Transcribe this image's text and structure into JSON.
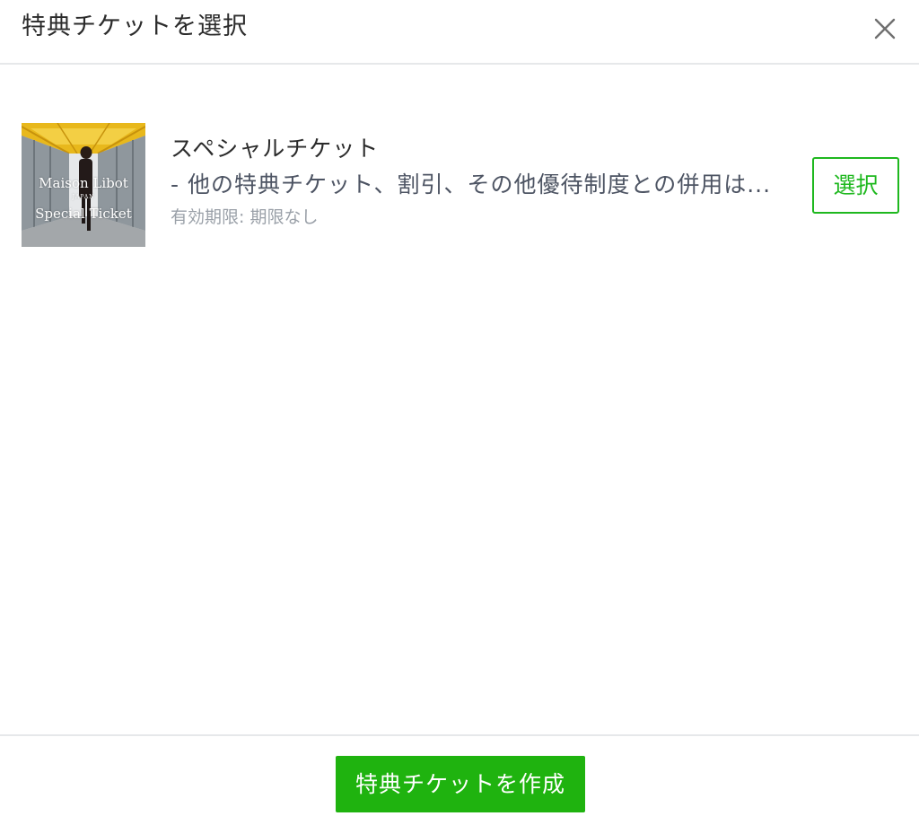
{
  "header": {
    "title": "特典チケットを選択",
    "close_icon": "close-icon"
  },
  "tickets": [
    {
      "name": "スペシャルチケット",
      "description": "- 他の特典チケット、割引、その他優待制度との併用は...",
      "expiry": "有効期限: 期限なし",
      "select_label": "選択",
      "thumbnail": {
        "line1": "Maison Libot",
        "line2": "JAPAN",
        "line3": "Special Ticket"
      }
    }
  ],
  "footer": {
    "create_label": "特典チケットを作成"
  },
  "colors": {
    "accent_green": "#1fb30f",
    "divider": "#e6e8ea",
    "muted_text": "#9aa0a8"
  }
}
